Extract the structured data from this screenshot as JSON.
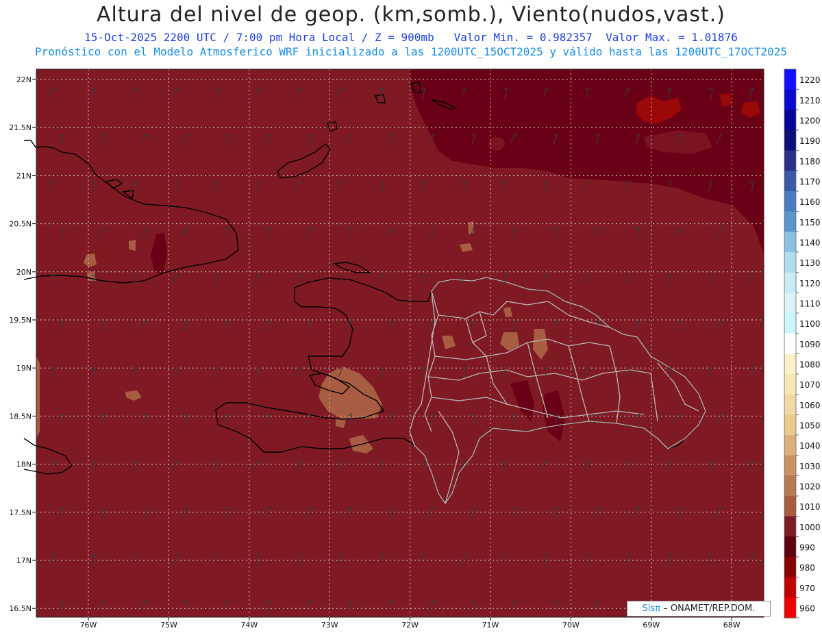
{
  "header": {
    "title": "Altura del nivel de geop. (km,somb.), Viento(nudos,vast.)",
    "subtitle_date": "15-Oct-2025  2200 UTC / 7:00 pm Hora Local / Z = 900mb",
    "subtitle_min": "Valor Min. = 0.982357",
    "subtitle_max": "Valor Max. = 1.01876",
    "model_line": "Pronóstico con el Modelo Atmosferico WRF inicializado a las 1200UTC_15OCT2025 y válido hasta las  1200UTC_17OCT2025"
  },
  "map": {
    "lat_labels": [
      "22N",
      "21.5N",
      "21N",
      "20.5N",
      "20N",
      "19.5N",
      "19N",
      "18.5N",
      "18N",
      "17.5N",
      "17N",
      "16.5N"
    ],
    "lon_labels": [
      "76W",
      "75W",
      "74W",
      "73W",
      "72W",
      "71W",
      "70W",
      "69W",
      "68W"
    ],
    "fill_color_main": "#7f1a24",
    "fill_color_dark": "#6a0016"
  },
  "colorbar": {
    "labels": [
      "1220",
      "1210",
      "1200",
      "1190",
      "1180",
      "1170",
      "1160",
      "1150",
      "1140",
      "1130",
      "1120",
      "1110",
      "1100",
      "1090",
      "1080",
      "1070",
      "1060",
      "1050",
      "1040",
      "1030",
      "1020",
      "1010",
      "1000",
      "990",
      "980",
      "970",
      "960"
    ],
    "colors": [
      "#1010ff",
      "#0a0ad0",
      "#05059a",
      "#0e0e78",
      "#2a2f8c",
      "#3a5aa8",
      "#4a7cc0",
      "#5b95cc",
      "#8cc0e0",
      "#b0dcec",
      "#c8ecf4",
      "#daf3f8",
      "#cdf6fa",
      "#ffffff",
      "#fbf0c8",
      "#f7e6b8",
      "#f1d8a4",
      "#ebca8e",
      "#dbb07a",
      "#c89464",
      "#b77a52",
      "#a85c42",
      "#7f1a24",
      "#600010",
      "#8a0000",
      "#c00000",
      "#f00000"
    ]
  },
  "credit": {
    "brand": "Sisπ",
    "org": "– ONAMET/REP.DOM."
  }
}
